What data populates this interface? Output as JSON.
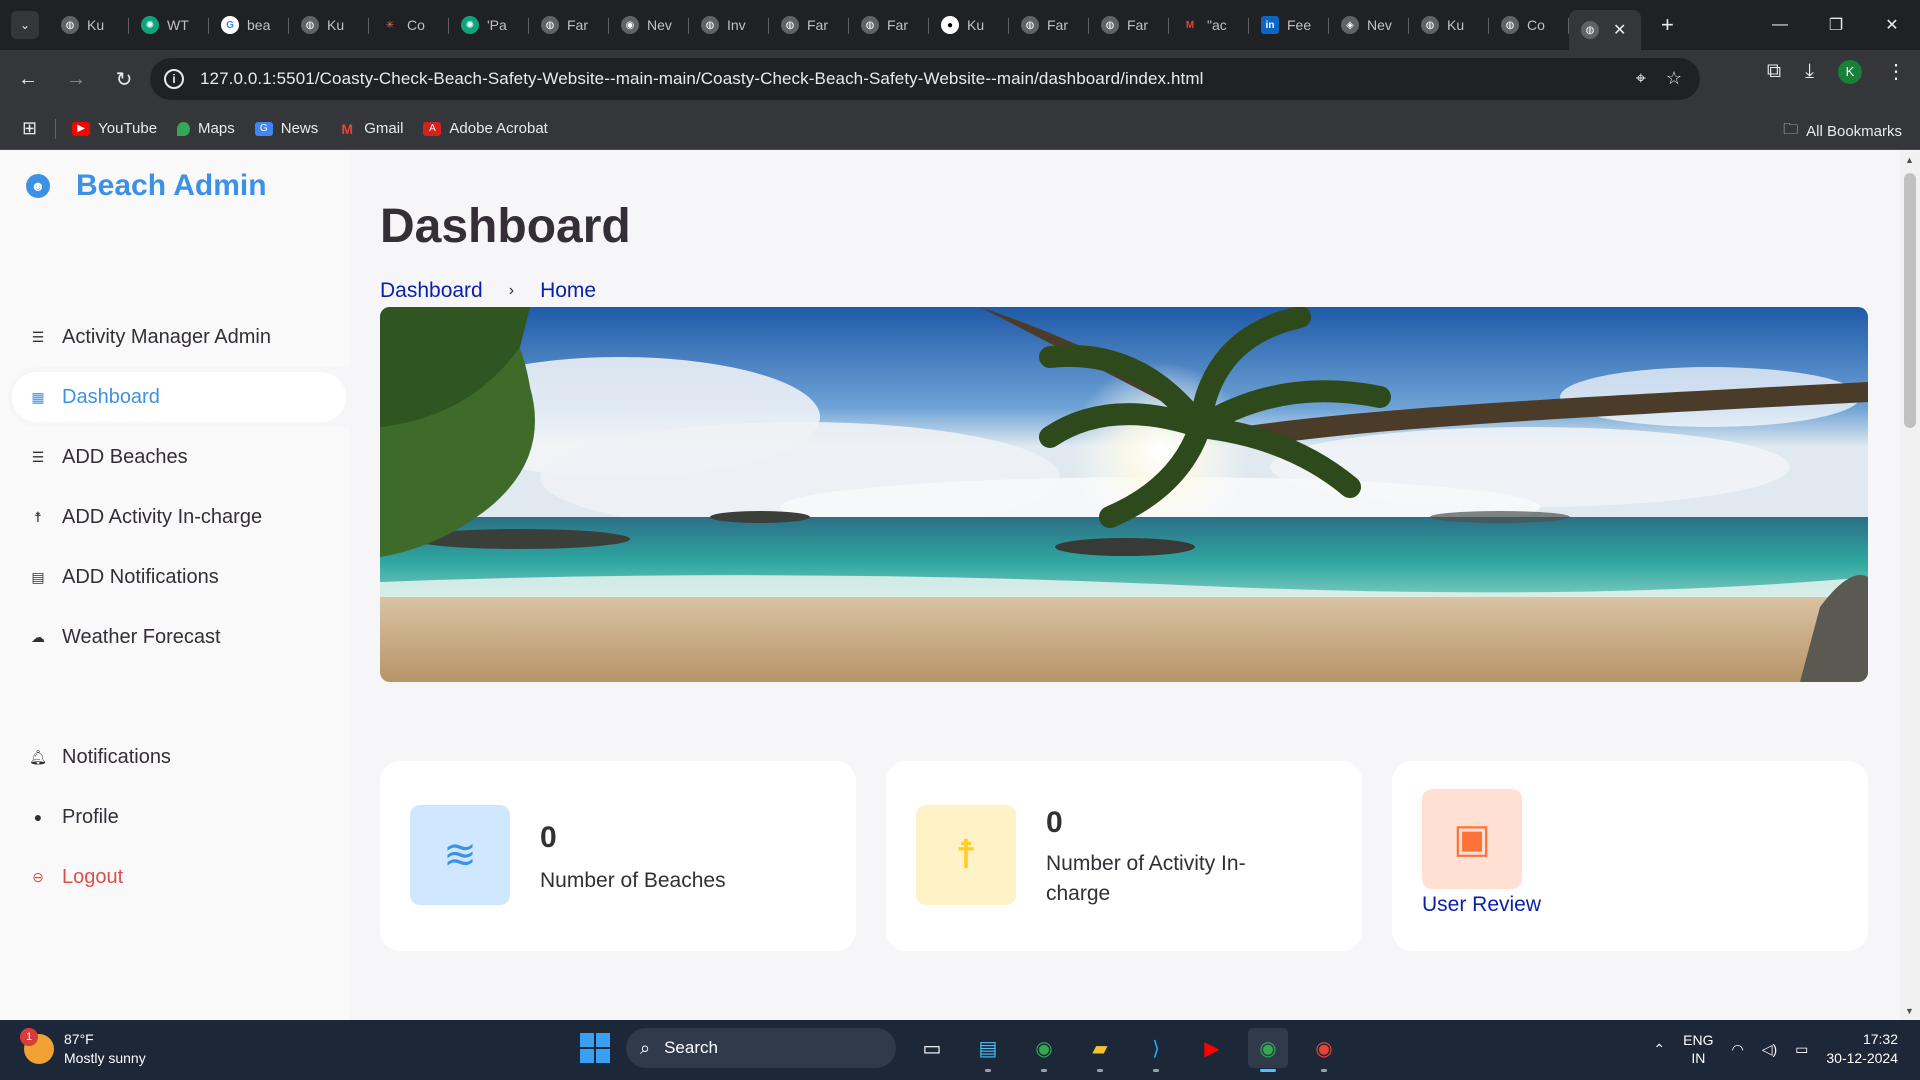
{
  "browser": {
    "tabs": [
      {
        "icon": "globe-icon",
        "title": "Ku"
      },
      {
        "icon": "chatgpt-icon",
        "title": "WT"
      },
      {
        "icon": "google-icon",
        "title": "bea"
      },
      {
        "icon": "globe-icon",
        "title": "Ku"
      },
      {
        "icon": "claude-icon",
        "title": "Co"
      },
      {
        "icon": "chatgpt-icon",
        "title": "'Pa"
      },
      {
        "icon": "globe-icon",
        "title": "Far"
      },
      {
        "icon": "chrome-icon",
        "title": "Nev"
      },
      {
        "icon": "globe-icon",
        "title": "Inv"
      },
      {
        "icon": "globe-icon",
        "title": "Far"
      },
      {
        "icon": "globe-icon",
        "title": "Far"
      },
      {
        "icon": "github-icon",
        "title": "Ku"
      },
      {
        "icon": "globe-icon",
        "title": "Far"
      },
      {
        "icon": "globe-icon",
        "title": "Far"
      },
      {
        "icon": "gmail-icon",
        "title": "\"ac"
      },
      {
        "icon": "linkedin-icon",
        "title": "Fee"
      },
      {
        "icon": "copilot-icon",
        "title": "Nev"
      },
      {
        "icon": "globe-icon",
        "title": "Ku"
      },
      {
        "icon": "globe-icon",
        "title": "Co"
      }
    ],
    "new_tab": "+",
    "url": "127.0.0.1:5501/Coasty-Check-Beach-Safety-Website--main-main/Coasty-Check-Beach-Safety-Website--main/dashboard/index.html",
    "profile_initial": "K",
    "bookmarks": [
      {
        "label": "YouTube",
        "color": "#ff0000"
      },
      {
        "label": "Maps",
        "color": "#34a853"
      },
      {
        "label": "News",
        "color": "#4285f4"
      },
      {
        "label": "Gmail",
        "color": "#ea4335"
      },
      {
        "label": "Adobe Acrobat",
        "color": "#d4211b"
      }
    ],
    "all_bookmarks": "All Bookmarks"
  },
  "sidebar": {
    "brand": "Beach Admin",
    "items": [
      {
        "label": "Activity Manager Admin",
        "icon": "list-icon"
      },
      {
        "label": "Dashboard",
        "icon": "dashboard-grid-icon"
      },
      {
        "label": "ADD Beaches",
        "icon": "list-icon"
      },
      {
        "label": "ADD Activity In-charge",
        "icon": "person-icon"
      },
      {
        "label": "ADD Notifications",
        "icon": "message-icon"
      },
      {
        "label": "Weather Forecast",
        "icon": "cloud-icon"
      }
    ],
    "bottom_items": [
      {
        "label": "Notifications",
        "icon": "bell-icon"
      },
      {
        "label": "Profile",
        "icon": "user-circle-icon"
      },
      {
        "label": "Logout",
        "icon": "logout-icon"
      }
    ]
  },
  "main": {
    "title": "Dashboard",
    "breadcrumb": [
      "Dashboard",
      "Home"
    ],
    "cards": [
      {
        "value": "0",
        "label": "Number of Beaches",
        "icon": "waves-icon",
        "icon_bg": "#cfe8ff",
        "icon_color": "#3c91e6"
      },
      {
        "value": "0",
        "label": "Number of Activity In-charge",
        "icon": "person-icon",
        "icon_bg": "#fff2c6",
        "icon_color": "#ffce26"
      },
      {
        "link": "User Review",
        "icon": "chat-icon",
        "icon_bg": "#ffe0d3",
        "icon_color": "#fd7238"
      }
    ]
  },
  "taskbar": {
    "weather_temp": "87°F",
    "weather_desc": "Mostly sunny",
    "weather_badge": "1",
    "search": "Search",
    "lang_1": "ENG",
    "lang_2": "IN",
    "time": "17:32",
    "date": "30-12-2024"
  },
  "colors": {
    "accent": "#3c91e6",
    "danger": "#db504a",
    "link": "#0b1fa8"
  }
}
